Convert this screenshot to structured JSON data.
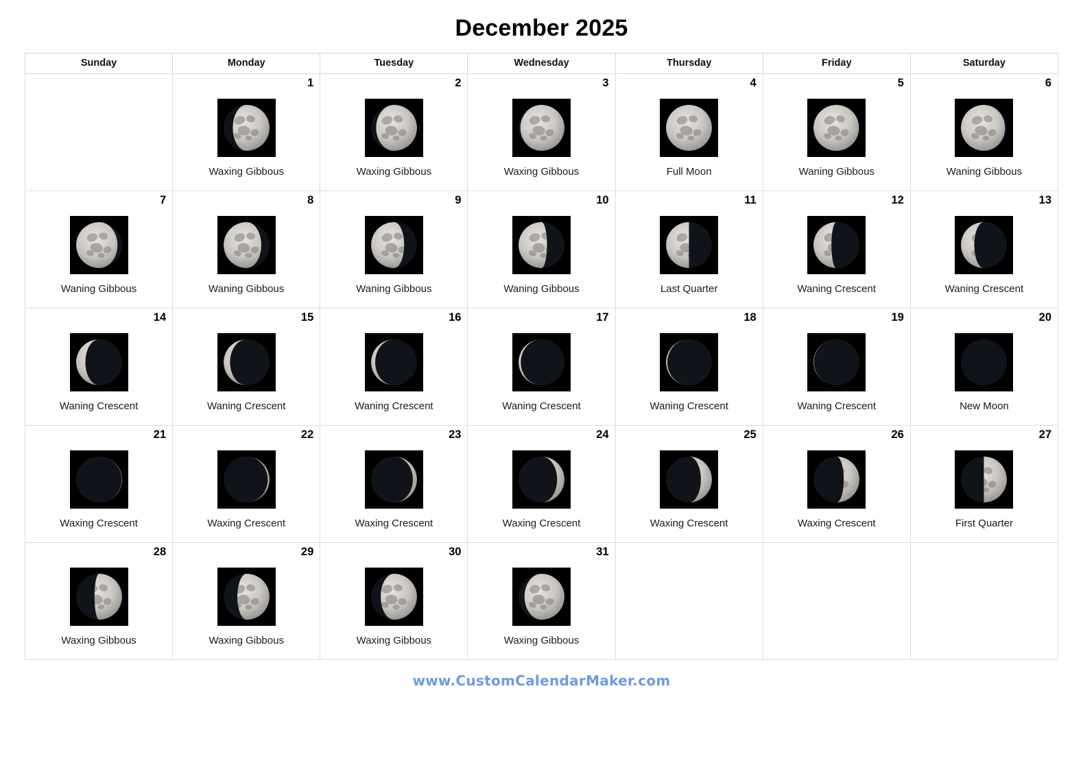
{
  "title": "December 2025",
  "weekday_headers": [
    "Sunday",
    "Monday",
    "Tuesday",
    "Wednesday",
    "Thursday",
    "Friday",
    "Saturday"
  ],
  "colors": {
    "grid_border": "#dcdcdc",
    "header_border": "#d6d6d6",
    "text": "#000000",
    "footer_link": "#6e9ae8",
    "moon_背景": "#000000"
  },
  "footer": {
    "link_text": "www.CustomCalendarMaker.com"
  },
  "weeks": [
    [
      {
        "day": "",
        "phase": "",
        "empty": true
      },
      {
        "day": "1",
        "phase": "Waxing Gibbous",
        "illum": 0.8,
        "waxing": true
      },
      {
        "day": "2",
        "phase": "Waxing Gibbous",
        "illum": 0.89,
        "waxing": true
      },
      {
        "day": "3",
        "phase": "Waxing Gibbous",
        "illum": 0.96,
        "waxing": true
      },
      {
        "day": "4",
        "phase": "Full Moon",
        "illum": 1.0,
        "waxing": true
      },
      {
        "day": "5",
        "phase": "Waning Gibbous",
        "illum": 0.99,
        "waxing": false
      },
      {
        "day": "6",
        "phase": "Waning Gibbous",
        "illum": 0.96,
        "waxing": false
      }
    ],
    [
      {
        "day": "7",
        "phase": "Waning Gibbous",
        "illum": 0.9,
        "waxing": false
      },
      {
        "day": "8",
        "phase": "Waning Gibbous",
        "illum": 0.82,
        "waxing": false
      },
      {
        "day": "9",
        "phase": "Waning Gibbous",
        "illum": 0.72,
        "waxing": false
      },
      {
        "day": "10",
        "phase": "Waning Gibbous",
        "illum": 0.62,
        "waxing": false
      },
      {
        "day": "11",
        "phase": "Last Quarter",
        "illum": 0.5,
        "waxing": false
      },
      {
        "day": "12",
        "phase": "Waning Crescent",
        "illum": 0.39,
        "waxing": false
      },
      {
        "day": "13",
        "phase": "Waning Crescent",
        "illum": 0.29,
        "waxing": false
      }
    ],
    [
      {
        "day": "14",
        "phase": "Waning Crescent",
        "illum": 0.2,
        "waxing": false
      },
      {
        "day": "15",
        "phase": "Waning Crescent",
        "illum": 0.14,
        "waxing": false
      },
      {
        "day": "16",
        "phase": "Waning Crescent",
        "illum": 0.09,
        "waxing": false
      },
      {
        "day": "17",
        "phase": "Waning Crescent",
        "illum": 0.05,
        "waxing": false
      },
      {
        "day": "18",
        "phase": "Waning Crescent",
        "illum": 0.03,
        "waxing": false
      },
      {
        "day": "19",
        "phase": "Waning Crescent",
        "illum": 0.01,
        "waxing": false
      },
      {
        "day": "20",
        "phase": "New Moon",
        "illum": 0.0,
        "waxing": true
      }
    ],
    [
      {
        "day": "21",
        "phase": "Waxing Crescent",
        "illum": 0.01,
        "waxing": true
      },
      {
        "day": "22",
        "phase": "Waxing Crescent",
        "illum": 0.04,
        "waxing": true
      },
      {
        "day": "23",
        "phase": "Waxing Crescent",
        "illum": 0.09,
        "waxing": true
      },
      {
        "day": "24",
        "phase": "Waxing Crescent",
        "illum": 0.16,
        "waxing": true
      },
      {
        "day": "25",
        "phase": "Waxing Crescent",
        "illum": 0.24,
        "waxing": true
      },
      {
        "day": "26",
        "phase": "Waxing Crescent",
        "illum": 0.34,
        "waxing": true
      },
      {
        "day": "27",
        "phase": "First Quarter",
        "illum": 0.5,
        "waxing": true
      }
    ],
    [
      {
        "day": "28",
        "phase": "Waxing Gibbous",
        "illum": 0.6,
        "waxing": true
      },
      {
        "day": "29",
        "phase": "Waxing Gibbous",
        "illum": 0.7,
        "waxing": true
      },
      {
        "day": "30",
        "phase": "Waxing Gibbous",
        "illum": 0.79,
        "waxing": true
      },
      {
        "day": "31",
        "phase": "Waxing Gibbous",
        "illum": 0.87,
        "waxing": true
      },
      {
        "day": "",
        "phase": "",
        "empty": true
      },
      {
        "day": "",
        "phase": "",
        "empty": true
      },
      {
        "day": "",
        "phase": "",
        "empty": true
      }
    ]
  ]
}
